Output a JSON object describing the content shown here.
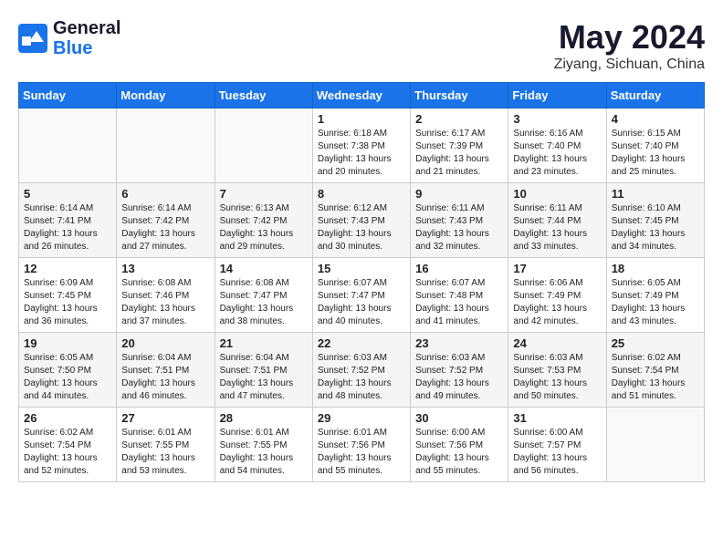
{
  "header": {
    "logo_line1": "General",
    "logo_line2": "Blue",
    "month_year": "May 2024",
    "location": "Ziyang, Sichuan, China"
  },
  "weekdays": [
    "Sunday",
    "Monday",
    "Tuesday",
    "Wednesday",
    "Thursday",
    "Friday",
    "Saturday"
  ],
  "weeks": [
    [
      {
        "day": "",
        "info": ""
      },
      {
        "day": "",
        "info": ""
      },
      {
        "day": "",
        "info": ""
      },
      {
        "day": "1",
        "info": "Sunrise: 6:18 AM\nSunset: 7:38 PM\nDaylight: 13 hours\nand 20 minutes."
      },
      {
        "day": "2",
        "info": "Sunrise: 6:17 AM\nSunset: 7:39 PM\nDaylight: 13 hours\nand 21 minutes."
      },
      {
        "day": "3",
        "info": "Sunrise: 6:16 AM\nSunset: 7:40 PM\nDaylight: 13 hours\nand 23 minutes."
      },
      {
        "day": "4",
        "info": "Sunrise: 6:15 AM\nSunset: 7:40 PM\nDaylight: 13 hours\nand 25 minutes."
      }
    ],
    [
      {
        "day": "5",
        "info": "Sunrise: 6:14 AM\nSunset: 7:41 PM\nDaylight: 13 hours\nand 26 minutes."
      },
      {
        "day": "6",
        "info": "Sunrise: 6:14 AM\nSunset: 7:42 PM\nDaylight: 13 hours\nand 27 minutes."
      },
      {
        "day": "7",
        "info": "Sunrise: 6:13 AM\nSunset: 7:42 PM\nDaylight: 13 hours\nand 29 minutes."
      },
      {
        "day": "8",
        "info": "Sunrise: 6:12 AM\nSunset: 7:43 PM\nDaylight: 13 hours\nand 30 minutes."
      },
      {
        "day": "9",
        "info": "Sunrise: 6:11 AM\nSunset: 7:43 PM\nDaylight: 13 hours\nand 32 minutes."
      },
      {
        "day": "10",
        "info": "Sunrise: 6:11 AM\nSunset: 7:44 PM\nDaylight: 13 hours\nand 33 minutes."
      },
      {
        "day": "11",
        "info": "Sunrise: 6:10 AM\nSunset: 7:45 PM\nDaylight: 13 hours\nand 34 minutes."
      }
    ],
    [
      {
        "day": "12",
        "info": "Sunrise: 6:09 AM\nSunset: 7:45 PM\nDaylight: 13 hours\nand 36 minutes."
      },
      {
        "day": "13",
        "info": "Sunrise: 6:08 AM\nSunset: 7:46 PM\nDaylight: 13 hours\nand 37 minutes."
      },
      {
        "day": "14",
        "info": "Sunrise: 6:08 AM\nSunset: 7:47 PM\nDaylight: 13 hours\nand 38 minutes."
      },
      {
        "day": "15",
        "info": "Sunrise: 6:07 AM\nSunset: 7:47 PM\nDaylight: 13 hours\nand 40 minutes."
      },
      {
        "day": "16",
        "info": "Sunrise: 6:07 AM\nSunset: 7:48 PM\nDaylight: 13 hours\nand 41 minutes."
      },
      {
        "day": "17",
        "info": "Sunrise: 6:06 AM\nSunset: 7:49 PM\nDaylight: 13 hours\nand 42 minutes."
      },
      {
        "day": "18",
        "info": "Sunrise: 6:05 AM\nSunset: 7:49 PM\nDaylight: 13 hours\nand 43 minutes."
      }
    ],
    [
      {
        "day": "19",
        "info": "Sunrise: 6:05 AM\nSunset: 7:50 PM\nDaylight: 13 hours\nand 44 minutes."
      },
      {
        "day": "20",
        "info": "Sunrise: 6:04 AM\nSunset: 7:51 PM\nDaylight: 13 hours\nand 46 minutes."
      },
      {
        "day": "21",
        "info": "Sunrise: 6:04 AM\nSunset: 7:51 PM\nDaylight: 13 hours\nand 47 minutes."
      },
      {
        "day": "22",
        "info": "Sunrise: 6:03 AM\nSunset: 7:52 PM\nDaylight: 13 hours\nand 48 minutes."
      },
      {
        "day": "23",
        "info": "Sunrise: 6:03 AM\nSunset: 7:52 PM\nDaylight: 13 hours\nand 49 minutes."
      },
      {
        "day": "24",
        "info": "Sunrise: 6:03 AM\nSunset: 7:53 PM\nDaylight: 13 hours\nand 50 minutes."
      },
      {
        "day": "25",
        "info": "Sunrise: 6:02 AM\nSunset: 7:54 PM\nDaylight: 13 hours\nand 51 minutes."
      }
    ],
    [
      {
        "day": "26",
        "info": "Sunrise: 6:02 AM\nSunset: 7:54 PM\nDaylight: 13 hours\nand 52 minutes."
      },
      {
        "day": "27",
        "info": "Sunrise: 6:01 AM\nSunset: 7:55 PM\nDaylight: 13 hours\nand 53 minutes."
      },
      {
        "day": "28",
        "info": "Sunrise: 6:01 AM\nSunset: 7:55 PM\nDaylight: 13 hours\nand 54 minutes."
      },
      {
        "day": "29",
        "info": "Sunrise: 6:01 AM\nSunset: 7:56 PM\nDaylight: 13 hours\nand 55 minutes."
      },
      {
        "day": "30",
        "info": "Sunrise: 6:00 AM\nSunset: 7:56 PM\nDaylight: 13 hours\nand 55 minutes."
      },
      {
        "day": "31",
        "info": "Sunrise: 6:00 AM\nSunset: 7:57 PM\nDaylight: 13 hours\nand 56 minutes."
      },
      {
        "day": "",
        "info": ""
      }
    ]
  ]
}
